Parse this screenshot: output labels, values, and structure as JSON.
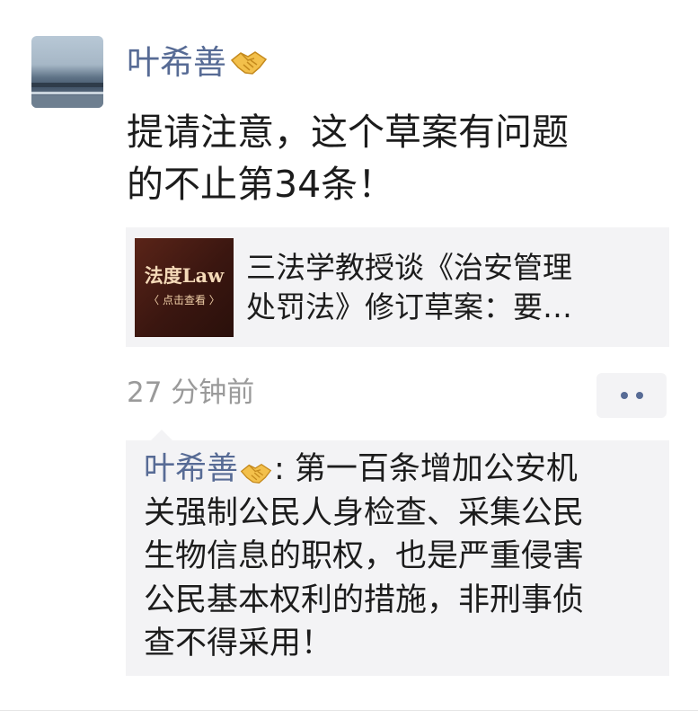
{
  "post": {
    "author": "叶希善",
    "author_badge_icon": "handshake-icon",
    "text_lines": [
      "提请注意，这个草案有问题",
      "的不止第34条！"
    ]
  },
  "link_card": {
    "thumbnail_title": "法度Law",
    "thumbnail_subtitle": "〈 点击查看 〉",
    "title_lines": [
      "三法学教授谈《治安管理",
      "处罚法》修订草案：要…"
    ]
  },
  "meta": {
    "timestamp": "27 分钟前",
    "more_icon": "more-dots-icon"
  },
  "comment": {
    "author": "叶希善",
    "author_badge_icon": "handshake-icon",
    "first_line_text": ": 第一百条增加公安机",
    "lines": [
      "关强制公民人身检查、采集公民",
      "生物信息的职权，也是严重侵害",
      "公民基本权利的措施，非刑事侦",
      "查不得采用！"
    ]
  },
  "colors": {
    "name_link": "#576b95",
    "text": "#1c1c1c",
    "muted": "#9a9a9a",
    "panel_bg": "#f3f3f5"
  }
}
